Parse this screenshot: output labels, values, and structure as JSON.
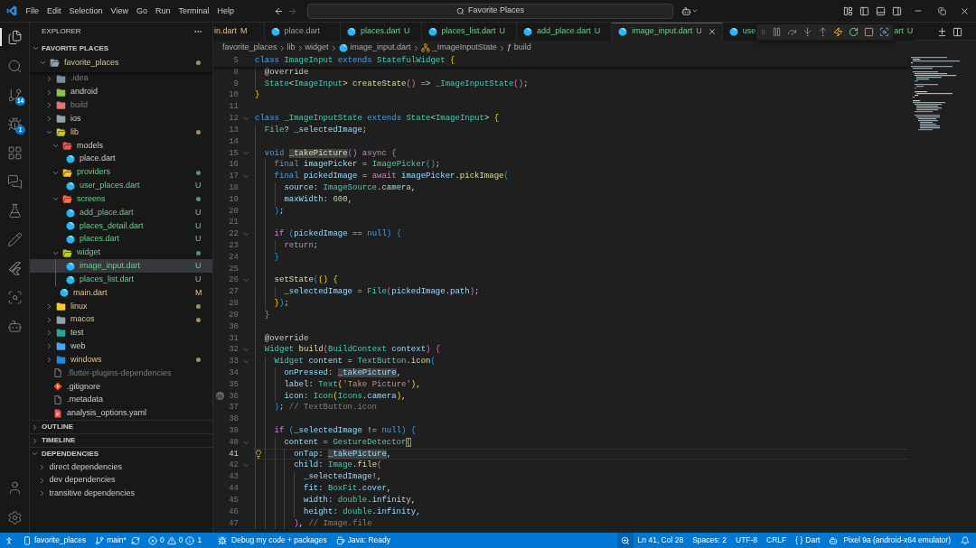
{
  "title_bar": {
    "menu": [
      "File",
      "Edit",
      "Selection",
      "View",
      "Go",
      "Run",
      "Terminal",
      "Help"
    ],
    "back": {
      "disabled": false
    },
    "forward": {
      "disabled": true
    },
    "command_center": {
      "label": "Favorite Places"
    }
  },
  "activity_bar": {
    "items": [
      {
        "selected": true
      },
      {
        "selected": false
      },
      {
        "selected": false,
        "badge": "14"
      },
      {
        "selected": false,
        "badge": "1"
      },
      {
        "selected": false
      },
      {
        "selected": false
      },
      {
        "selected": false
      },
      {
        "selected": false
      },
      {
        "selected": false
      },
      {
        "selected": false
      },
      {
        "selected": false
      }
    ]
  },
  "explorer": {
    "title": "EXPLORER",
    "workspace": {
      "label": "FAVORITE PLACES",
      "expanded": true
    },
    "tree": [
      {
        "label": "favorite_places",
        "kind": "folder",
        "modified": true,
        "untracked": false,
        "ignored": false,
        "expanded": true,
        "selected": false,
        "children": [
          {
            "label": ".idea",
            "kind": "idea",
            "modified": false,
            "untracked": false,
            "ignored": true,
            "expanded": false,
            "selected": false
          },
          {
            "label": "android",
            "kind": "android",
            "modified": false,
            "untracked": false,
            "ignored": false,
            "expanded": false,
            "selected": false
          },
          {
            "label": "build",
            "kind": "build",
            "modified": false,
            "untracked": false,
            "ignored": true,
            "expanded": false,
            "selected": false
          },
          {
            "label": "ios",
            "kind": "ios",
            "modified": false,
            "untracked": false,
            "ignored": false,
            "expanded": false,
            "selected": false
          },
          {
            "label": "lib",
            "kind": "lib",
            "modified": true,
            "untracked": false,
            "ignored": false,
            "expanded": true,
            "selected": false,
            "children": [
              {
                "label": "models",
                "kind": "models",
                "modified": false,
                "untracked": false,
                "ignored": false,
                "expanded": true,
                "selected": false,
                "children": [
                  {
                    "label": "place.dart",
                    "kind": "dart",
                    "modified": false,
                    "untracked": false,
                    "ignored": false,
                    "selected": false
                  }
                ]
              },
              {
                "label": "providers",
                "kind": "providers",
                "modified": false,
                "untracked": true,
                "ignored": false,
                "expanded": true,
                "selected": false,
                "children": [
                  {
                    "label": "user_places.dart",
                    "kind": "dart",
                    "modified": false,
                    "untracked": true,
                    "ignored": false,
                    "badge": "U",
                    "selected": false
                  }
                ]
              },
              {
                "label": "screens",
                "kind": "screens",
                "modified": false,
                "untracked": true,
                "ignored": false,
                "expanded": true,
                "selected": false,
                "children": [
                  {
                    "label": "add_place.dart",
                    "kind": "dart",
                    "modified": false,
                    "untracked": true,
                    "ignored": false,
                    "badge": "U",
                    "selected": false
                  },
                  {
                    "label": "places_detail.dart",
                    "kind": "dart",
                    "modified": false,
                    "untracked": true,
                    "ignored": false,
                    "badge": "U",
                    "selected": false
                  },
                  {
                    "label": "places.dart",
                    "kind": "dart",
                    "modified": false,
                    "untracked": true,
                    "ignored": false,
                    "badge": "U",
                    "selected": false
                  }
                ]
              },
              {
                "label": "widget",
                "kind": "widget",
                "modified": false,
                "untracked": true,
                "ignored": false,
                "expanded": true,
                "selected": false,
                "children": [
                  {
                    "label": "image_input.dart",
                    "kind": "dart",
                    "modified": false,
                    "untracked": true,
                    "ignored": false,
                    "badge": "U",
                    "selected": true
                  },
                  {
                    "label": "places_list.dart",
                    "kind": "dart",
                    "modified": false,
                    "untracked": true,
                    "ignored": false,
                    "badge": "U",
                    "selected": false
                  }
                ]
              },
              {
                "label": "main.dart",
                "kind": "dart",
                "modified": true,
                "untracked": false,
                "ignored": false,
                "badge": "M",
                "selected": false
              }
            ]
          },
          {
            "label": "linux",
            "kind": "linux",
            "modified": true,
            "untracked": false,
            "ignored": false,
            "expanded": false,
            "selected": false
          },
          {
            "label": "macos",
            "kind": "macos",
            "modified": true,
            "untracked": false,
            "ignored": false,
            "expanded": false,
            "selected": false
          },
          {
            "label": "test",
            "kind": "test",
            "modified": false,
            "untracked": false,
            "ignored": false,
            "expanded": false,
            "selected": false
          },
          {
            "label": "web",
            "kind": "web",
            "modified": false,
            "untracked": false,
            "ignored": false,
            "expanded": false,
            "selected": false
          },
          {
            "label": "windows",
            "kind": "windows",
            "modified": true,
            "untracked": false,
            "ignored": false,
            "expanded": false,
            "selected": false
          },
          {
            "label": ".flutter-plugins-dependencies",
            "kind": "file",
            "modified": false,
            "untracked": false,
            "ignored": true,
            "selected": false
          },
          {
            "label": ".gitignore",
            "kind": "git",
            "modified": false,
            "untracked": false,
            "ignored": false,
            "selected": false
          },
          {
            "label": ".metadata",
            "kind": "file",
            "modified": false,
            "untracked": false,
            "ignored": false,
            "selected": false
          },
          {
            "label": "analysis_options.yaml",
            "kind": "yaml",
            "modified": false,
            "untracked": false,
            "ignored": false,
            "selected": false
          }
        ]
      }
    ],
    "sections": [
      {
        "label": "OUTLINE",
        "expanded": false
      },
      {
        "label": "TIMELINE",
        "expanded": false
      },
      {
        "label": "DEPENDENCIES",
        "expanded": true,
        "children": [
          {
            "label": "direct dependencies",
            "expanded": false
          },
          {
            "label": "dev dependencies",
            "expanded": false
          },
          {
            "label": "transitive dependencies",
            "expanded": false
          }
        ]
      }
    ]
  },
  "editor": {
    "tabs": [
      {
        "kind": "clipped",
        "label": "in.dart",
        "badge": "M",
        "modified": true,
        "untracked": false,
        "selected": false
      },
      {
        "kind": "dart",
        "label": "place.dart",
        "modified": false,
        "untracked": false,
        "selected": false
      },
      {
        "kind": "dart",
        "label": "places.dart",
        "badge": "U",
        "modified": false,
        "untracked": true,
        "selected": false
      },
      {
        "kind": "dart",
        "label": "places_list.dart",
        "badge": "U",
        "modified": false,
        "untracked": true,
        "selected": false
      },
      {
        "kind": "dart",
        "label": "add_place.dart",
        "badge": "U",
        "modified": false,
        "untracked": true,
        "selected": false
      },
      {
        "kind": "dart",
        "label": "image_input.dart",
        "badge": "U",
        "modified": false,
        "untracked": true,
        "selected": true
      },
      {
        "kind": "covered",
        "label": "use",
        "modified": false,
        "untracked": true,
        "selected": false
      },
      {
        "kind": "fragment",
        "label": "art",
        "badge": "U",
        "modified": false,
        "untracked": true,
        "selected": false
      }
    ],
    "breadcrumbs": [
      {
        "kind": "folder",
        "label": "favorite_places"
      },
      {
        "kind": "folder",
        "label": "lib"
      },
      {
        "kind": "folder",
        "label": "widget"
      },
      {
        "kind": "dart",
        "label": "image_input.dart"
      },
      {
        "kind": "class",
        "label": "_ImageInputState"
      },
      {
        "kind": "function",
        "symbol": "ƒ",
        "label": "build"
      }
    ],
    "sticky_line": {
      "number": "5",
      "fold": false,
      "current": false,
      "tokens": [
        {
          "text": "class ",
          "kind": "kw"
        },
        {
          "text": "ImageInput ",
          "kind": "type"
        },
        {
          "text": "extends ",
          "kind": "kw"
        },
        {
          "text": "StatefulWidget ",
          "kind": "type"
        },
        {
          "text": "{",
          "kind": "b1"
        }
      ]
    },
    "lines": [
      {
        "number": "8",
        "fold": false,
        "current": false,
        "tokens": [
          {
            "text": "  @override",
            "kind": "anno"
          }
        ]
      },
      {
        "number": "9",
        "fold": false,
        "current": false,
        "tokens": [
          {
            "text": "  State",
            "kind": "type"
          },
          {
            "text": "<",
            "kind": "punc"
          },
          {
            "text": "ImageInput",
            "kind": "type"
          },
          {
            "text": "> ",
            "kind": "punc"
          },
          {
            "text": "createState",
            "kind": "fn"
          },
          {
            "text": "()",
            "kind": "b2"
          },
          {
            "text": " => ",
            "kind": "punc"
          },
          {
            "text": "_ImageInputState",
            "kind": "type"
          },
          {
            "text": "()",
            "kind": "b2"
          },
          {
            "text": ";",
            "kind": "punc"
          }
        ]
      },
      {
        "number": "10",
        "fold": false,
        "current": false,
        "tokens": [
          {
            "text": "}",
            "kind": "b1"
          }
        ]
      },
      {
        "number": "11",
        "fold": false,
        "current": false
      },
      {
        "number": "12",
        "fold": true,
        "current": false,
        "tokens": [
          {
            "text": "class ",
            "kind": "kw"
          },
          {
            "text": "_ImageInputState ",
            "kind": "type"
          },
          {
            "text": "extends ",
            "kind": "kw"
          },
          {
            "text": "State",
            "kind": "type"
          },
          {
            "text": "<",
            "kind": "punc"
          },
          {
            "text": "ImageInput",
            "kind": "type"
          },
          {
            "text": "> ",
            "kind": "punc"
          },
          {
            "text": "{",
            "kind": "b1"
          }
        ]
      },
      {
        "number": "13",
        "fold": false,
        "current": false,
        "tokens": [
          {
            "text": "  File",
            "kind": "type"
          },
          {
            "text": "? ",
            "kind": "punc"
          },
          {
            "text": "_selectedImage",
            "kind": "var"
          },
          {
            "text": ";",
            "kind": "punc"
          }
        ]
      },
      {
        "number": "14",
        "fold": false,
        "current": false
      },
      {
        "number": "15",
        "fold": true,
        "current": false,
        "tokens": [
          {
            "text": "  void ",
            "kind": "kw"
          },
          {
            "text": "_takePicture",
            "kind": "fn",
            "highlight": true
          },
          {
            "text": "()",
            "kind": "b2"
          },
          {
            "text": " async ",
            "kind": "ctrl"
          },
          {
            "text": "{",
            "kind": "b2"
          }
        ]
      },
      {
        "number": "16",
        "fold": false,
        "current": false,
        "tokens": [
          {
            "text": "    final ",
            "kind": "kw"
          },
          {
            "text": "imagePicker",
            "kind": "var"
          },
          {
            "text": " = ",
            "kind": "punc"
          },
          {
            "text": "ImagePicker",
            "kind": "type"
          },
          {
            "text": "()",
            "kind": "b3"
          },
          {
            "text": ";",
            "kind": "punc"
          }
        ]
      },
      {
        "number": "17",
        "fold": true,
        "current": false,
        "tokens": [
          {
            "text": "    final ",
            "kind": "kw"
          },
          {
            "text": "pickedImage",
            "kind": "var"
          },
          {
            "text": " = ",
            "kind": "punc"
          },
          {
            "text": "await ",
            "kind": "ctrl"
          },
          {
            "text": "imagePicker",
            "kind": "var"
          },
          {
            "text": ".",
            "kind": "punc"
          },
          {
            "text": "pickImage",
            "kind": "fn"
          },
          {
            "text": "(",
            "kind": "b3"
          }
        ]
      },
      {
        "number": "18",
        "fold": false,
        "current": false,
        "tokens": [
          {
            "text": "      source",
            "kind": "var"
          },
          {
            "text": ": ",
            "kind": "punc"
          },
          {
            "text": "ImageSource",
            "kind": "type"
          },
          {
            "text": ".",
            "kind": "punc"
          },
          {
            "text": "camera",
            "kind": "var"
          },
          {
            "text": ",",
            "kind": "punc"
          }
        ]
      },
      {
        "number": "19",
        "fold": false,
        "current": false,
        "tokens": [
          {
            "text": "      maxWidth",
            "kind": "var"
          },
          {
            "text": ": ",
            "kind": "punc"
          },
          {
            "text": "600",
            "kind": "num"
          },
          {
            "text": ",",
            "kind": "punc"
          }
        ]
      },
      {
        "number": "20",
        "fold": false,
        "current": false,
        "tokens": [
          {
            "text": "    )",
            "kind": "b3"
          },
          {
            "text": ";",
            "kind": "punc"
          }
        ]
      },
      {
        "number": "21",
        "fold": false,
        "current": false
      },
      {
        "number": "22",
        "fold": true,
        "current": false,
        "tokens": [
          {
            "text": "    if ",
            "kind": "ctrl"
          },
          {
            "text": "(",
            "kind": "b3"
          },
          {
            "text": "pickedImage",
            "kind": "var"
          },
          {
            "text": " == ",
            "kind": "punc"
          },
          {
            "text": "null",
            "kind": "kw"
          },
          {
            "text": ") {",
            "kind": "b3"
          }
        ]
      },
      {
        "number": "23",
        "fold": false,
        "current": false,
        "tokens": [
          {
            "text": "      return",
            "kind": "ctrl"
          },
          {
            "text": ";",
            "kind": "punc"
          }
        ]
      },
      {
        "number": "24",
        "fold": false,
        "current": false,
        "tokens": [
          {
            "text": "    }",
            "kind": "b3"
          }
        ]
      },
      {
        "number": "25",
        "fold": false,
        "current": false
      },
      {
        "number": "26",
        "fold": true,
        "current": false,
        "tokens": [
          {
            "text": "    setState",
            "kind": "fn"
          },
          {
            "text": "(",
            "kind": "b3"
          },
          {
            "text": "() {",
            "kind": "b1"
          }
        ]
      },
      {
        "number": "27",
        "fold": false,
        "current": false,
        "tokens": [
          {
            "text": "      _selectedImage",
            "kind": "var"
          },
          {
            "text": " = ",
            "kind": "punc"
          },
          {
            "text": "File",
            "kind": "type"
          },
          {
            "text": "(",
            "kind": "b2"
          },
          {
            "text": "pickedImage",
            "kind": "var"
          },
          {
            "text": ".",
            "kind": "punc"
          },
          {
            "text": "path",
            "kind": "var"
          },
          {
            "text": ")",
            "kind": "b2"
          },
          {
            "text": ";",
            "kind": "punc"
          }
        ]
      },
      {
        "number": "28",
        "fold": false,
        "current": false,
        "tokens": [
          {
            "text": "    }",
            "kind": "b1"
          },
          {
            "text": ")",
            "kind": "b3"
          },
          {
            "text": ";",
            "kind": "punc"
          }
        ]
      },
      {
        "number": "29",
        "fold": false,
        "current": false,
        "tokens": [
          {
            "text": "  }",
            "kind": "b2"
          }
        ]
      },
      {
        "number": "30",
        "fold": false,
        "current": false
      },
      {
        "number": "31",
        "fold": false,
        "current": false,
        "tokens": [
          {
            "text": "  @override",
            "kind": "anno"
          }
        ]
      },
      {
        "number": "32",
        "fold": true,
        "current": false,
        "tokens": [
          {
            "text": "  Widget ",
            "kind": "type"
          },
          {
            "text": "build",
            "kind": "fn"
          },
          {
            "text": "(",
            "kind": "b2"
          },
          {
            "text": "BuildContext ",
            "kind": "type"
          },
          {
            "text": "context",
            "kind": "var"
          },
          {
            "text": ") {",
            "kind": "b2"
          }
        ]
      },
      {
        "number": "33",
        "fold": true,
        "current": false,
        "tokens": [
          {
            "text": "    Widget ",
            "kind": "type"
          },
          {
            "text": "content",
            "kind": "var"
          },
          {
            "text": " = ",
            "kind": "punc"
          },
          {
            "text": "TextButton",
            "kind": "type"
          },
          {
            "text": ".",
            "kind": "punc"
          },
          {
            "text": "icon",
            "kind": "fn"
          },
          {
            "text": "(",
            "kind": "b3"
          }
        ]
      },
      {
        "number": "34",
        "fold": false,
        "current": false,
        "tokens": [
          {
            "text": "      onPressed",
            "kind": "var"
          },
          {
            "text": ": ",
            "kind": "punc"
          },
          {
            "text": "_takePicture",
            "kind": "var",
            "highlight": true
          },
          {
            "text": ",",
            "kind": "punc"
          }
        ]
      },
      {
        "number": "35",
        "fold": false,
        "current": false,
        "tokens": [
          {
            "text": "      label",
            "kind": "var"
          },
          {
            "text": ": ",
            "kind": "punc"
          },
          {
            "text": "Text",
            "kind": "type"
          },
          {
            "text": "(",
            "kind": "b1"
          },
          {
            "text": "'Take Picture'",
            "kind": "str"
          },
          {
            "text": ")",
            "kind": "b1"
          },
          {
            "text": ",",
            "kind": "punc"
          }
        ]
      },
      {
        "number": "36",
        "fold": false,
        "current": false,
        "icon_preview": true,
        "tokens": [
          {
            "text": "      icon",
            "kind": "var"
          },
          {
            "text": ": ",
            "kind": "punc"
          },
          {
            "text": "Icon",
            "kind": "type"
          },
          {
            "text": "(",
            "kind": "b1"
          },
          {
            "text": "Icons",
            "kind": "type"
          },
          {
            "text": ".",
            "kind": "punc"
          },
          {
            "text": "camera",
            "kind": "var"
          },
          {
            "text": ")",
            "kind": "b1"
          },
          {
            "text": ",",
            "kind": "punc"
          }
        ]
      },
      {
        "number": "37",
        "fold": false,
        "current": false,
        "tokens": [
          {
            "text": "    )",
            "kind": "b3"
          },
          {
            "text": ";",
            "kind": "punc"
          },
          {
            "text": " // TextButton.icon",
            "kind": "hint"
          }
        ]
      },
      {
        "number": "38",
        "fold": false,
        "current": false
      },
      {
        "number": "39",
        "fold": false,
        "current": false,
        "tokens": [
          {
            "text": "    if ",
            "kind": "ctrl"
          },
          {
            "text": "(",
            "kind": "b3"
          },
          {
            "text": "_selectedImage",
            "kind": "var"
          },
          {
            "text": " != ",
            "kind": "punc"
          },
          {
            "text": "null",
            "kind": "kw"
          },
          {
            "text": ") {",
            "kind": "b3"
          }
        ]
      },
      {
        "number": "40",
        "fold": true,
        "current": false,
        "tokens": [
          {
            "text": "      content",
            "kind": "var"
          },
          {
            "text": " = ",
            "kind": "punc"
          },
          {
            "text": "GestureDetector",
            "kind": "type"
          },
          {
            "text": "(",
            "kind": "b1",
            "bracket_match": true
          }
        ]
      },
      {
        "number": "41",
        "fold": false,
        "current": true,
        "code_action": true,
        "tokens": [
          {
            "text": "        onTap",
            "kind": "var"
          },
          {
            "text": ": ",
            "kind": "punc"
          },
          {
            "text": "_takePicture",
            "kind": "var",
            "highlight": true
          },
          {
            "text": ",",
            "kind": "punc"
          }
        ]
      },
      {
        "number": "42",
        "fold": true,
        "current": false,
        "tokens": [
          {
            "text": "        child",
            "kind": "var"
          },
          {
            "text": ": ",
            "kind": "punc"
          },
          {
            "text": "Image",
            "kind": "type"
          },
          {
            "text": ".",
            "kind": "punc"
          },
          {
            "text": "file",
            "kind": "fn"
          },
          {
            "text": "(",
            "kind": "b2"
          }
        ]
      },
      {
        "number": "43",
        "fold": false,
        "current": false,
        "tokens": [
          {
            "text": "          _selectedImage",
            "kind": "var"
          },
          {
            "text": "!,",
            "kind": "punc"
          }
        ]
      },
      {
        "number": "44",
        "fold": false,
        "current": false,
        "tokens": [
          {
            "text": "          fit",
            "kind": "var"
          },
          {
            "text": ": ",
            "kind": "punc"
          },
          {
            "text": "BoxFit",
            "kind": "type"
          },
          {
            "text": ".",
            "kind": "punc"
          },
          {
            "text": "cover",
            "kind": "var"
          },
          {
            "text": ",",
            "kind": "punc"
          }
        ]
      },
      {
        "number": "45",
        "fold": false,
        "current": false,
        "tokens": [
          {
            "text": "          width",
            "kind": "var"
          },
          {
            "text": ": ",
            "kind": "punc"
          },
          {
            "text": "double",
            "kind": "type"
          },
          {
            "text": ".",
            "kind": "punc"
          },
          {
            "text": "infinity",
            "kind": "var"
          },
          {
            "text": ",",
            "kind": "punc"
          }
        ]
      },
      {
        "number": "46",
        "fold": false,
        "current": false,
        "tokens": [
          {
            "text": "          height",
            "kind": "var"
          },
          {
            "text": ": ",
            "kind": "punc"
          },
          {
            "text": "double",
            "kind": "type"
          },
          {
            "text": ".",
            "kind": "punc"
          },
          {
            "text": "infinity",
            "kind": "var"
          },
          {
            "text": ",",
            "kind": "punc"
          }
        ]
      },
      {
        "number": "47",
        "fold": false,
        "current": false,
        "tokens": [
          {
            "text": "        )",
            "kind": "b2"
          },
          {
            "text": ",",
            "kind": "punc"
          },
          {
            "text": " // Image.file",
            "kind": "hint"
          }
        ]
      }
    ]
  },
  "status_bar": {
    "project": "favorite_places",
    "branch": "main*",
    "problems": {
      "errors": "0",
      "warnings": "0",
      "infos": "1"
    },
    "debug_mode": "Debug my code + packages",
    "java_status": "Java: Ready",
    "cursor": "Ln 41, Col 28",
    "indentation": "Spaces: 2",
    "encoding": "UTF-8",
    "line_ending": "CRLF",
    "language": {
      "symbol": "{ }",
      "label": "Dart"
    },
    "device": "Pixel 9a (android-x64 emulator)"
  }
}
